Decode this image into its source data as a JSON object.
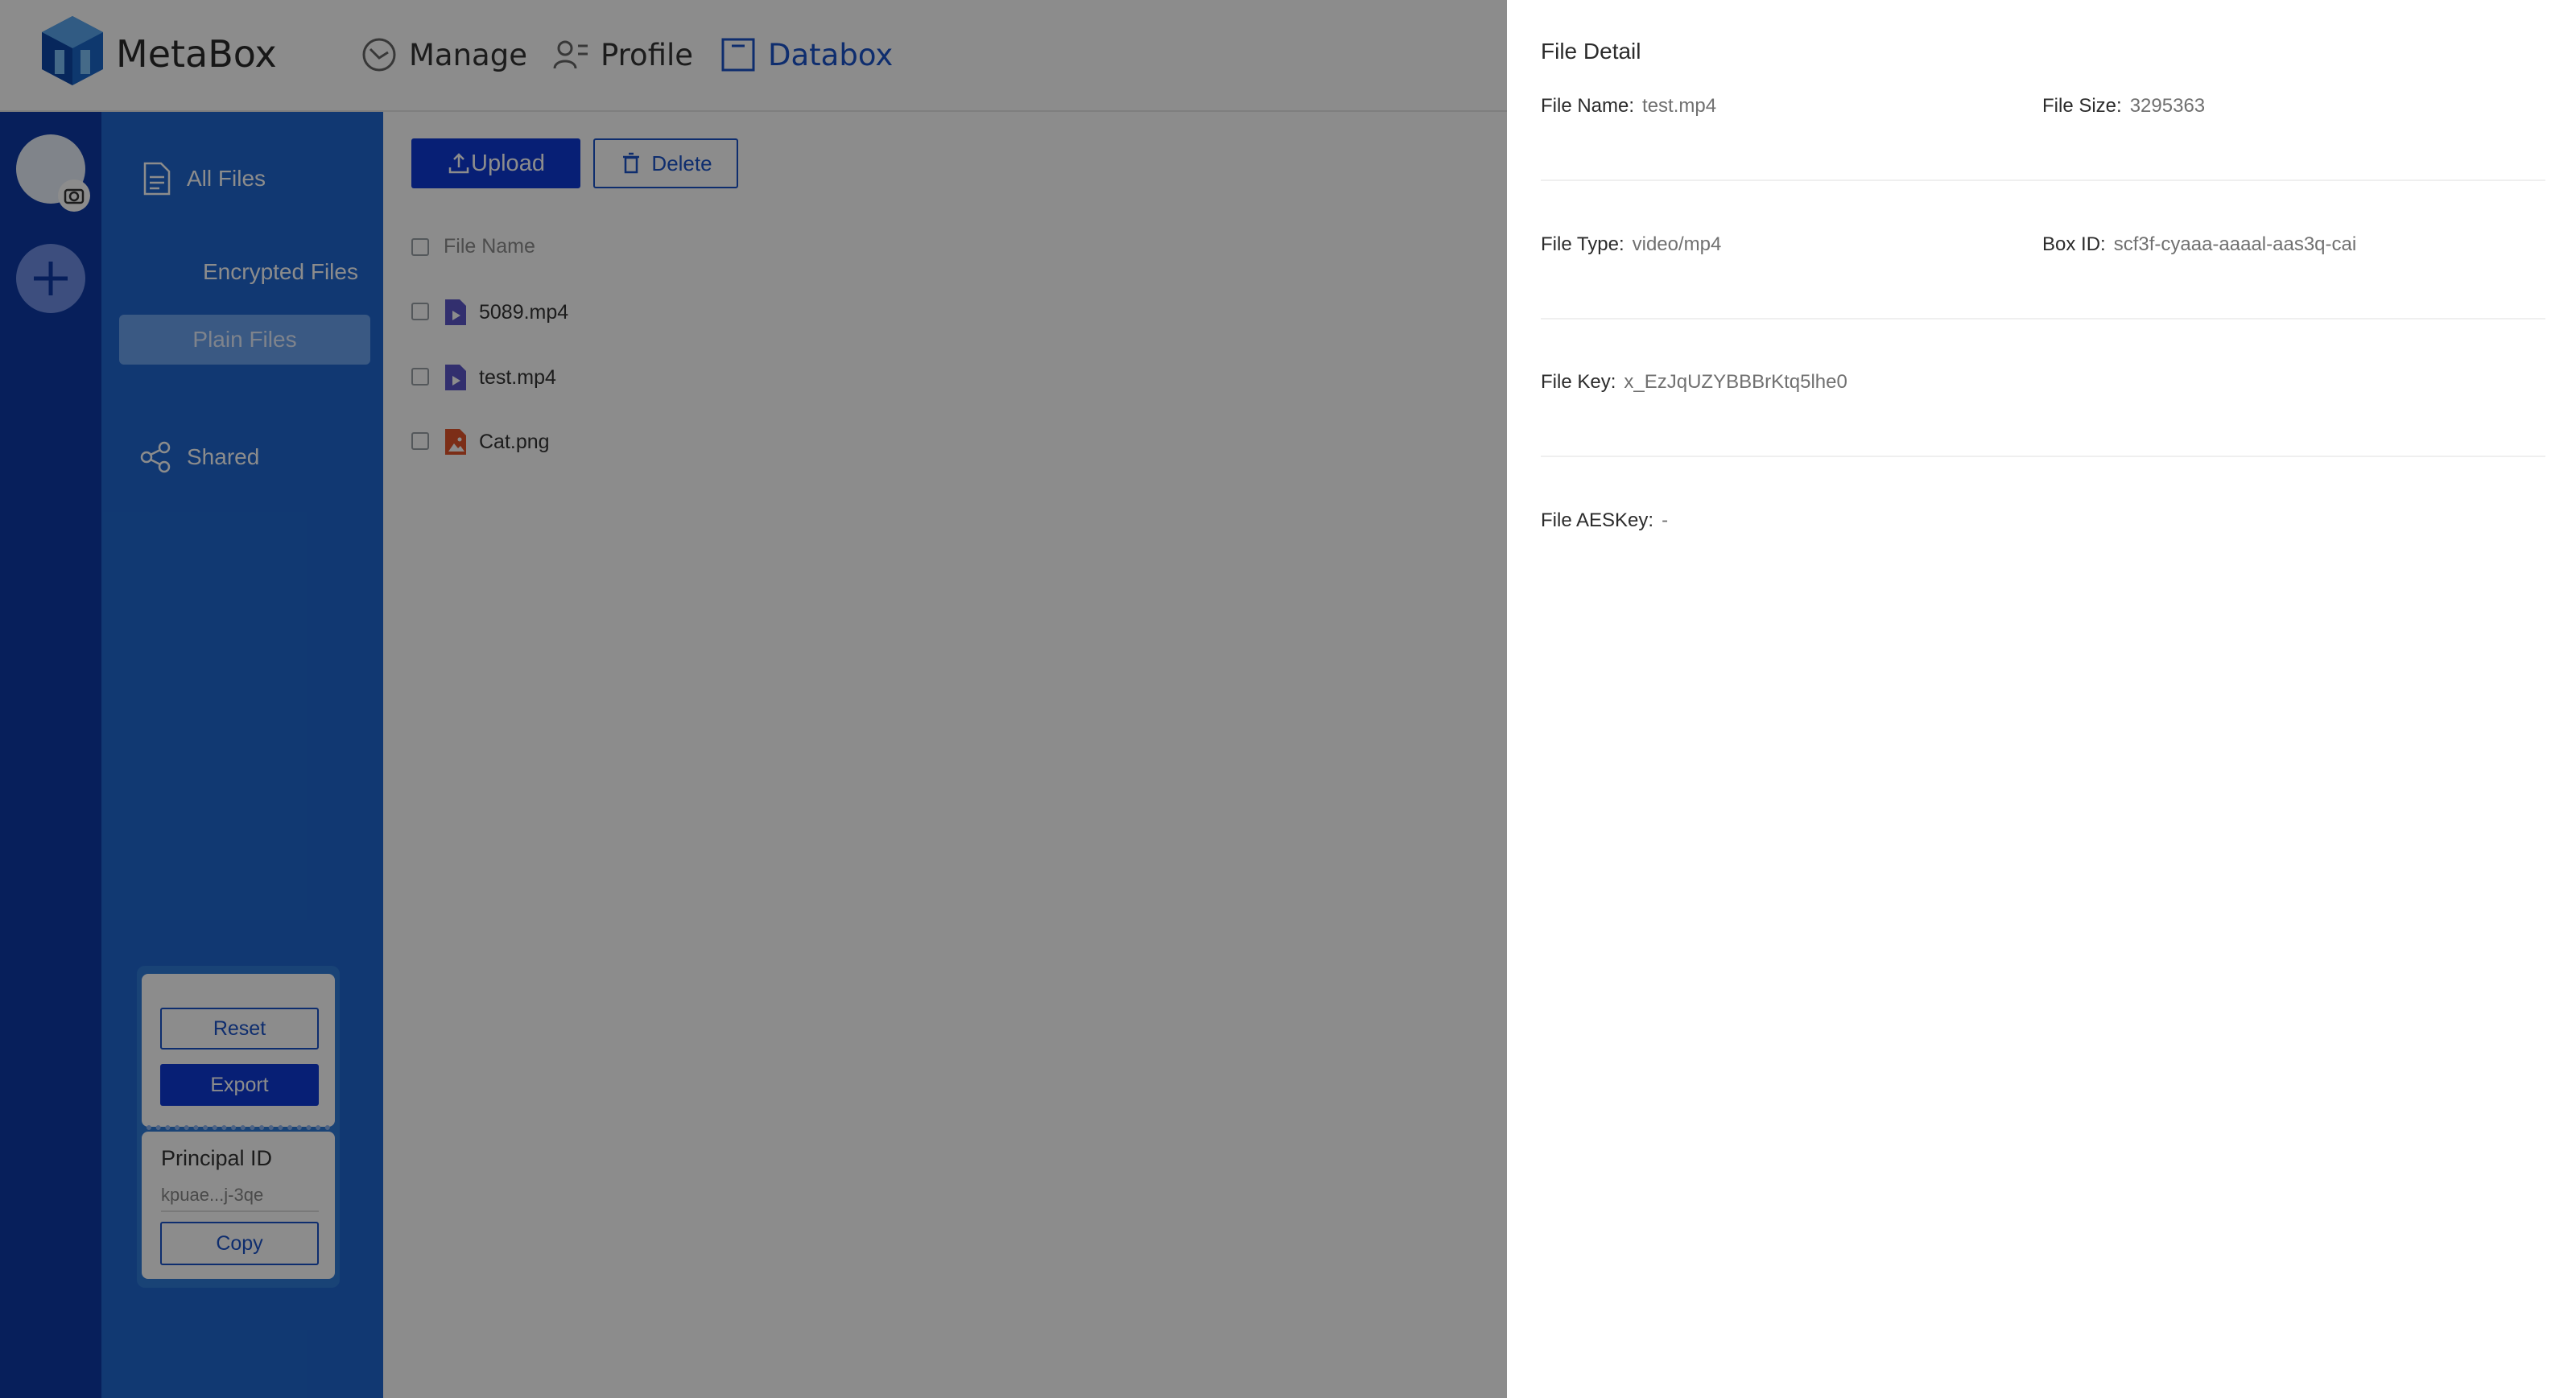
{
  "header": {
    "brand": "MetaBox",
    "nav": [
      {
        "label": "Manage",
        "icon": "gauge-icon"
      },
      {
        "label": "Profile",
        "icon": "profile-icon"
      },
      {
        "label": "Databox",
        "icon": "box-icon",
        "active": true
      }
    ]
  },
  "sidebar": {
    "items": [
      {
        "label": "All Files",
        "icon": "document-icon"
      },
      {
        "label": "Encrypted Files"
      },
      {
        "label": "Plain Files",
        "selected": true
      },
      {
        "label": "Shared",
        "icon": "share-icon"
      }
    ],
    "reset_label": "Reset",
    "export_label": "Export",
    "principal_label": "Principal ID",
    "principal_value": "kpuae...j-3qe",
    "copy_label": "Copy"
  },
  "toolbar": {
    "upload_label": "Upload",
    "delete_label": "Delete"
  },
  "table": {
    "header": "File Name",
    "rows": [
      {
        "name": "5089.mp4",
        "icon": "video-file-icon"
      },
      {
        "name": "test.mp4",
        "icon": "video-file-icon"
      },
      {
        "name": "Cat.png",
        "icon": "image-file-icon"
      }
    ]
  },
  "drawer": {
    "title": "File Detail",
    "file_name_label": "File Name:",
    "file_name": "test.mp4",
    "file_size_label": "File Size:",
    "file_size": "3295363",
    "file_type_label": "File Type:",
    "file_type": "video/mp4",
    "box_id_label": "Box ID:",
    "box_id": "scf3f-cyaaa-aaaal-aas3q-cai",
    "file_key_label": "File Key:",
    "file_key": "x_EzJqUZYBBBrKtq5lhe0",
    "aes_key_label": "File AESKey:",
    "aes_key": "-"
  },
  "colors": {
    "rail": "#0d3aa6",
    "sidebar": "#1f67cf",
    "accent": "#0d3ad6",
    "active_nav": "#1b52c9"
  }
}
